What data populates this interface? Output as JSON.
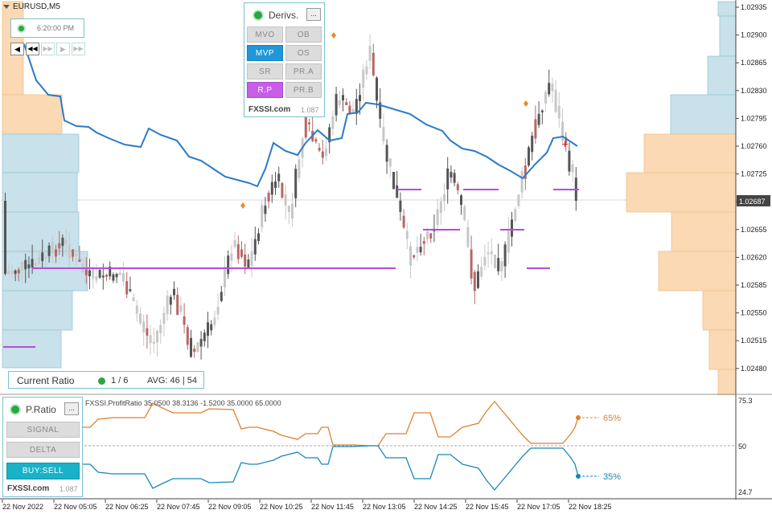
{
  "symbol": "EURUSD,M5",
  "clock": "6:20:00 PM",
  "nav_buttons": [
    "◂",
    "◂◂",
    "▸▸",
    "▸",
    "▸▸|"
  ],
  "derivs": {
    "title": "Derivs.",
    "menu": "...",
    "buttons": [
      "MVO",
      "OB",
      "MVP",
      "OS",
      "SR",
      "PR.A",
      "R.P",
      "PR.B"
    ],
    "footer": "FXSSI.com",
    "version": "1.087"
  },
  "current_ratio": {
    "label": "Current Ratio",
    "count": "1 / 6",
    "avg": "AVG: 46 | 54"
  },
  "pratio": {
    "title": "P.Ratio",
    "menu": "...",
    "buttons": [
      "SIGNAL",
      "DELTA",
      "BUY:SELL"
    ],
    "footer": "FXSSI.com",
    "version": "1.087"
  },
  "indicator_label": "FXSSI.ProfitRatio 35.0500 38.3136 -1.5200 35.0000 65.0000",
  "price_axis": [
    "1.02935",
    "1.02900",
    "1.02865",
    "1.02830",
    "1.02795",
    "1.02760",
    "1.02725",
    "1.02690",
    "1.02655",
    "1.02620",
    "1.02585",
    "1.02550",
    "1.02515",
    "1.02480"
  ],
  "current_price": "1.02687",
  "sub_axis": [
    "75.3",
    "50",
    "24.7"
  ],
  "time_axis": [
    "22 Nov 2022",
    "22 Nov 05:05",
    "22 Nov 06:25",
    "22 Nov 07:45",
    "22 Nov 09:05",
    "22 Nov 10:25",
    "22 Nov 11:45",
    "22 Nov 13:05",
    "22 Nov 14:25",
    "22 Nov 15:45",
    "22 Nov 17:05",
    "22 Nov 18:25"
  ],
  "ratio_buy": "65%",
  "ratio_sell": "35%",
  "colors": {
    "bull": "#555555",
    "bear": "#b56767",
    "neutral": "#c8c8c8",
    "blue_line": "#2a7bc7",
    "magenta": "#b44ed6",
    "orange": "#e88a2e",
    "vp_orange": "#fad9b4",
    "vp_blue": "#c8e1ea",
    "accent": "#2196d9",
    "buy_sell": "#19b2c8"
  }
}
